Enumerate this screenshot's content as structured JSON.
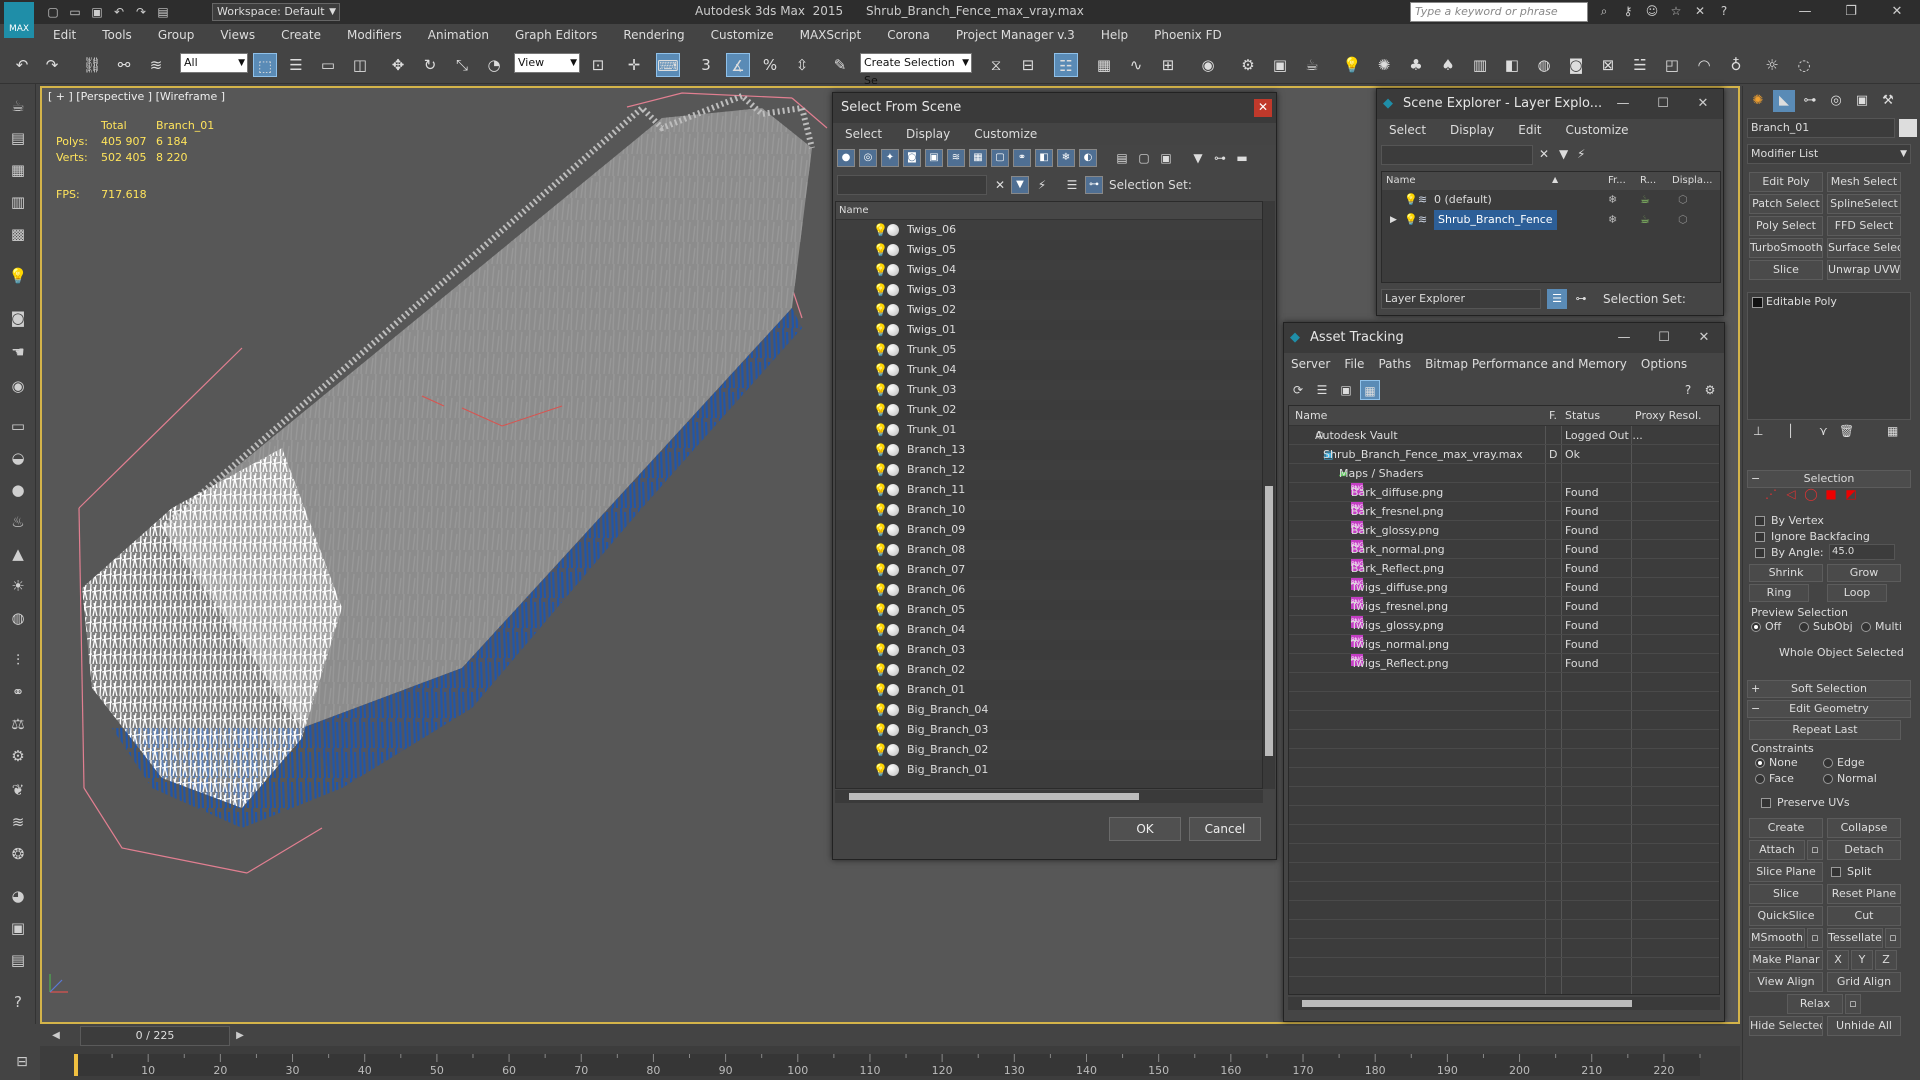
{
  "titlebar": {
    "logo": "MAX",
    "workspace": "Workspace: Default",
    "title": "Autodesk 3ds Max  2015      Shrub_Branch_Fence_max_vray.max",
    "search_placeholder": "Type a keyword or phrase"
  },
  "menu": [
    "Edit",
    "Tools",
    "Group",
    "Views",
    "Create",
    "Modifiers",
    "Animation",
    "Graph Editors",
    "Rendering",
    "Customize",
    "MAXScript",
    "Corona",
    "Project Manager v.3",
    "Help",
    "Phoenix FD"
  ],
  "toolbar": {
    "selection_filter": "All",
    "ref_coord": "View",
    "named_sel_placeholder": "Create Selection Se"
  },
  "viewport": {
    "label": "[ + ] [Perspective ] [Wireframe ]",
    "stats": {
      "header_total": "Total",
      "header_object": "Branch_01",
      "polys_label": "Polys:",
      "polys_total": "405 907",
      "polys_object": "6 184",
      "verts_label": "Verts:",
      "verts_total": "502 405",
      "verts_object": "8 220",
      "fps_label": "FPS:",
      "fps_value": "717.618"
    }
  },
  "select_from_scene": {
    "title": "Select From Scene",
    "menu": [
      "Select",
      "Display",
      "Customize"
    ],
    "selection_set_label": "Selection Set:",
    "column_name": "Name",
    "items": [
      "Twigs_06",
      "Twigs_05",
      "Twigs_04",
      "Twigs_03",
      "Twigs_02",
      "Twigs_01",
      "Trunk_05",
      "Trunk_04",
      "Trunk_03",
      "Trunk_02",
      "Trunk_01",
      "Branch_13",
      "Branch_12",
      "Branch_11",
      "Branch_10",
      "Branch_09",
      "Branch_08",
      "Branch_07",
      "Branch_06",
      "Branch_05",
      "Branch_04",
      "Branch_03",
      "Branch_02",
      "Branch_01",
      "Big_Branch_04",
      "Big_Branch_03",
      "Big_Branch_02",
      "Big_Branch_01"
    ],
    "ok_label": "OK",
    "cancel_label": "Cancel"
  },
  "scene_explorer": {
    "title": "Scene Explorer - Layer Explo...",
    "menu": [
      "Select",
      "Display",
      "Edit",
      "Customize"
    ],
    "columns": [
      "Name",
      "Fr...",
      "R...",
      "Displa..."
    ],
    "layers": [
      {
        "name": "0 (default)",
        "selected": false
      },
      {
        "name": "Shrub_Branch_Fence",
        "selected": true
      }
    ],
    "explorer_mode": "Layer Explorer",
    "selection_set_label": "Selection Set:"
  },
  "asset_tracking": {
    "title": "Asset Tracking",
    "menu": [
      "Server",
      "File",
      "Paths",
      "Bitmap Performance and Memory",
      "Options"
    ],
    "columns": [
      "Name",
      "F.",
      "Status",
      "Proxy Resol."
    ],
    "rows": [
      {
        "name": "Autodesk Vault",
        "flag": "",
        "status": "Logged Out ..."
      },
      {
        "name": "Shrub_Branch_Fence_max_vray.max",
        "flag": "D",
        "status": "Ok"
      },
      {
        "name": "Maps / Shaders",
        "flag": "",
        "status": ""
      },
      {
        "name": "Bark_diffuse.png",
        "flag": "",
        "status": "Found"
      },
      {
        "name": "Bark_fresnel.png",
        "flag": "",
        "status": "Found"
      },
      {
        "name": "Bark_glossy.png",
        "flag": "",
        "status": "Found"
      },
      {
        "name": "Bark_normal.png",
        "flag": "",
        "status": "Found"
      },
      {
        "name": "Bark_Reflect.png",
        "flag": "",
        "status": "Found"
      },
      {
        "name": "Twigs_diffuse.png",
        "flag": "",
        "status": "Found"
      },
      {
        "name": "Twigs_fresnel.png",
        "flag": "",
        "status": "Found"
      },
      {
        "name": "Twigs_glossy.png",
        "flag": "",
        "status": "Found"
      },
      {
        "name": "Twigs_normal.png",
        "flag": "",
        "status": "Found"
      },
      {
        "name": "Twigs_Reflect.png",
        "flag": "",
        "status": "Found"
      }
    ],
    "png_badge": "PNG"
  },
  "command_panel": {
    "object_name": "Branch_01",
    "modifier_list": "Modifier List",
    "modifier_buttons": [
      "Edit Poly",
      "Mesh Select",
      "Patch Select",
      "SplineSelect",
      "Poly Select",
      "FFD Select",
      "TurboSmooth",
      "Surface Select",
      "Slice",
      "Unwrap UVW"
    ],
    "stack_item": "Editable Poly",
    "selection": {
      "title": "Selection",
      "by_vertex": "By Vertex",
      "ignore_backfacing": "Ignore Backfacing",
      "by_angle": "By Angle:",
      "angle_value": "45.0",
      "shrink": "Shrink",
      "grow": "Grow",
      "ring": "Ring",
      "loop": "Loop",
      "preview_selection": "Preview Selection",
      "preview_off": "Off",
      "preview_subobj": "SubObj",
      "preview_multi": "Multi",
      "whole_object": "Whole Object Selected"
    },
    "soft_selection": "Soft Selection",
    "edit_geometry": {
      "title": "Edit Geometry",
      "repeat_last": "Repeat Last",
      "constraints": "Constraints",
      "none": "None",
      "edge": "Edge",
      "face": "Face",
      "normal": "Normal",
      "preserve_uvs": "Preserve UVs",
      "create": "Create",
      "collapse": "Collapse",
      "attach": "Attach",
      "detach": "Detach",
      "slice_plane": "Slice Plane",
      "split": "Split",
      "slice": "Slice",
      "reset_plane": "Reset Plane",
      "quickslice": "QuickSlice",
      "cut": "Cut",
      "msmooth": "MSmooth",
      "tessellate": "Tessellate",
      "make_planar": "Make Planar",
      "x": "X",
      "y": "Y",
      "z": "Z",
      "view_align": "View Align",
      "grid_align": "Grid Align",
      "relax": "Relax",
      "hide_selected": "Hide Selected",
      "unhide_all": "Unhide All"
    }
  },
  "timeline": {
    "frame": "0 / 225",
    "ticks": [
      "10",
      "20",
      "30",
      "40",
      "50",
      "60",
      "70",
      "80",
      "90",
      "100",
      "110",
      "120",
      "130",
      "140",
      "150",
      "160",
      "170",
      "180",
      "190",
      "200",
      "210",
      "220"
    ]
  }
}
